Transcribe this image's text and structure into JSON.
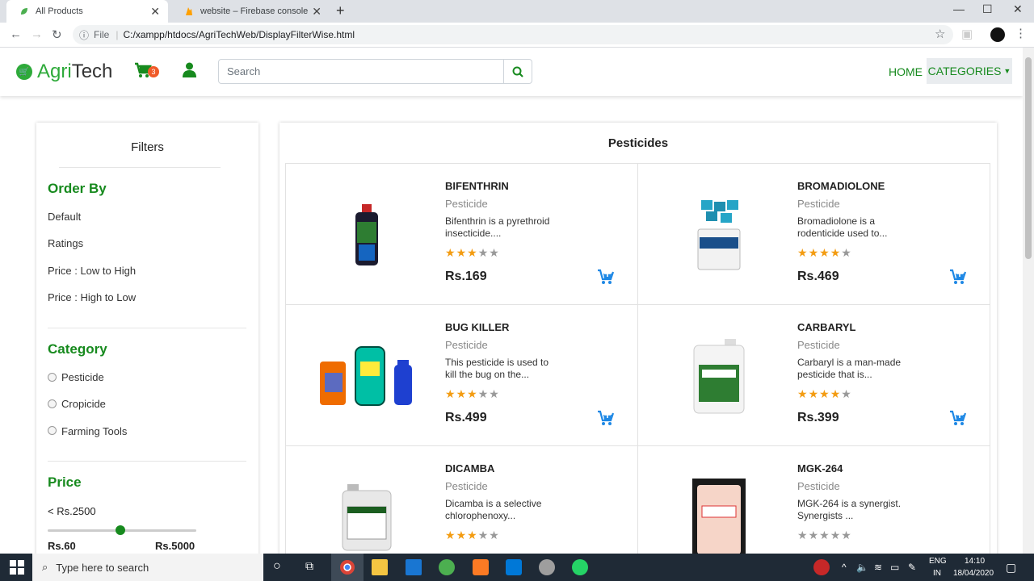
{
  "browser": {
    "tabs": [
      {
        "title": "All Products"
      },
      {
        "title": "website – Firebase console"
      }
    ],
    "file_label": "File",
    "url": "C:/xampp/htdocs/AgriTechWeb/DisplayFilterWise.html"
  },
  "navbar": {
    "logo_prefix": "Agri",
    "logo_suffix": "Tech",
    "cart_count": "3",
    "search_placeholder": "Search",
    "home_label": "HOME",
    "categories_label": "CATEGORIES"
  },
  "filters": {
    "title": "Filters",
    "order_by": {
      "heading": "Order By",
      "options": [
        "Default",
        "Ratings",
        "Price : Low to High",
        "Price : High to Low"
      ]
    },
    "category": {
      "heading": "Category",
      "options": [
        "Pesticide",
        "Cropicide",
        "Farming Tools"
      ]
    },
    "price": {
      "heading": "Price",
      "current": "< Rs.2500",
      "min_label": "Rs.60",
      "max_label": "Rs.5000",
      "slider_fraction": 0.49
    }
  },
  "products": {
    "heading": "Pesticides",
    "items": [
      {
        "name": "BIFENTHRIN",
        "category": "Pesticide",
        "desc": "Bifenthrin is a pyrethroid insecticide....",
        "rating": 3,
        "price": "Rs.169"
      },
      {
        "name": "BROMADIOLONE",
        "category": "Pesticide",
        "desc": "Bromadiolone is a rodenticide used to...",
        "rating": 4,
        "price": "Rs.469"
      },
      {
        "name": "BUG KILLER",
        "category": "Pesticide",
        "desc": "This pesticide is used to kill the bug on the...",
        "rating": 3,
        "price": "Rs.499"
      },
      {
        "name": "CARBARYL",
        "category": "Pesticide",
        "desc": "Carbaryl is a man-made pesticide that is...",
        "rating": 4,
        "price": "Rs.399"
      },
      {
        "name": "DICAMBA",
        "category": "Pesticide",
        "desc": "Dicamba is a selective chlorophenoxy...",
        "rating": 3,
        "price": ""
      },
      {
        "name": "MGK-264",
        "category": "Pesticide",
        "desc": "MGK-264 is a synergist. Synergists ...",
        "rating": 0,
        "price": ""
      }
    ],
    "max_rating": 5
  },
  "taskbar": {
    "search_placeholder": "Type here to search",
    "lang": "ENG",
    "region": "IN",
    "time": "14:10",
    "date": "18/04/2020"
  },
  "colors": {
    "brand_green": "#178a1e",
    "cart_blue": "#1e88e5",
    "star_on": "#f39c12",
    "star_off": "#999999"
  }
}
